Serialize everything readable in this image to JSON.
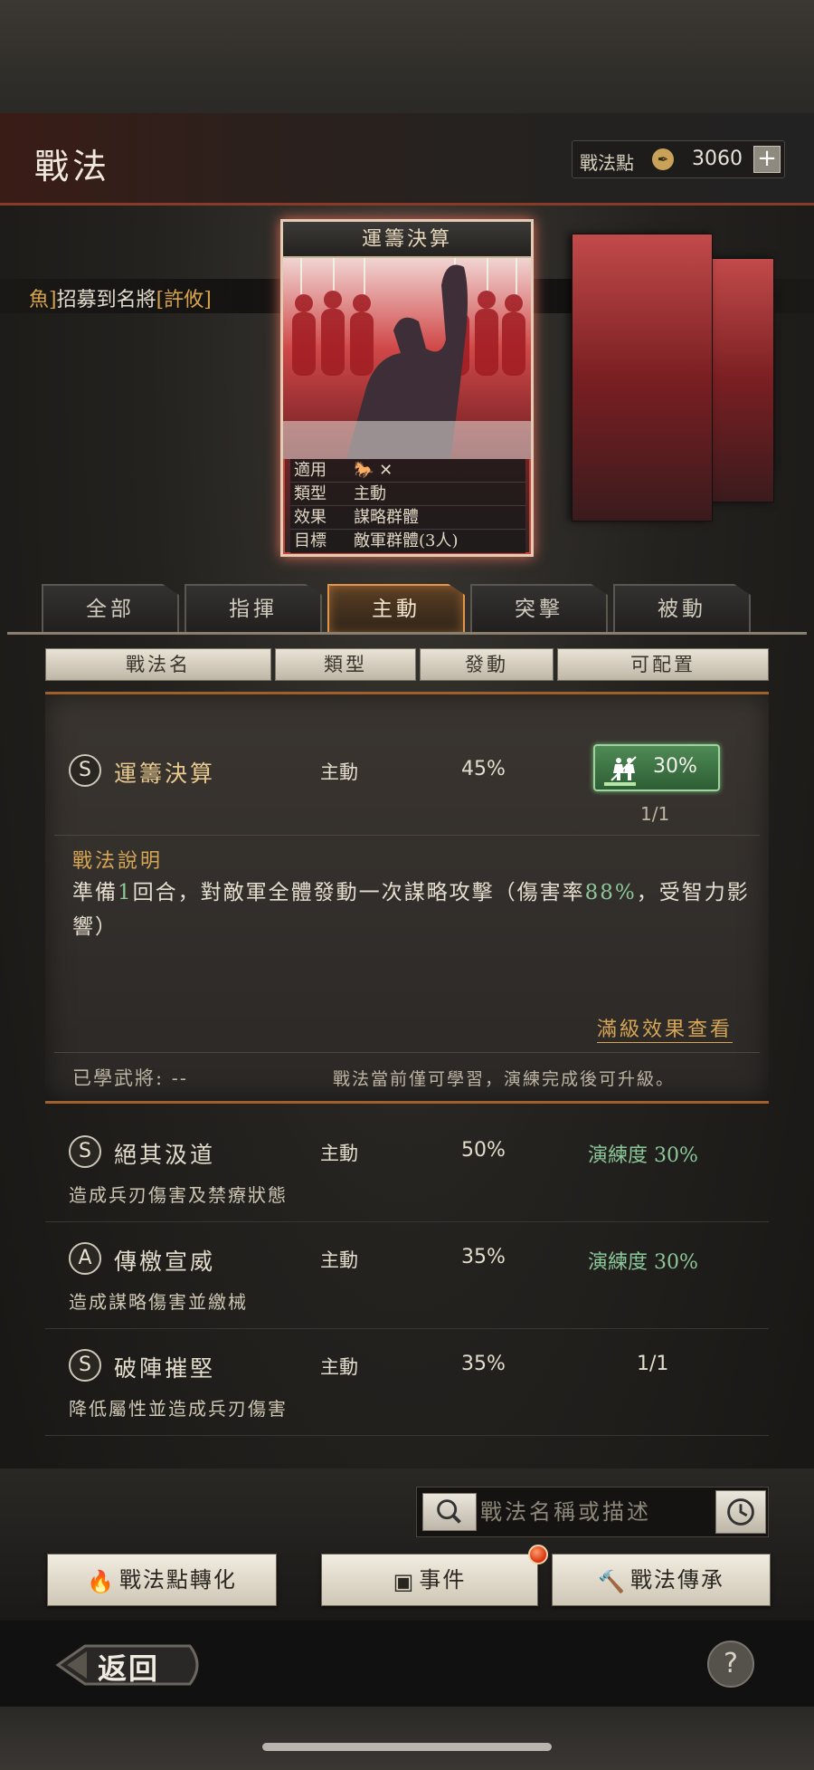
{
  "header": {
    "title": "戰法",
    "points_label": "戰法點",
    "points_value": "3060",
    "points_add": "+"
  },
  "ticker": {
    "prefix": "魚]",
    "middle": "招募到名將",
    "name": "[許攸]"
  },
  "card": {
    "title": "運籌決算",
    "info": [
      {
        "key": "適用",
        "value": ""
      },
      {
        "key": "類型",
        "value": "主動"
      },
      {
        "key": "效果",
        "value": "謀略群體"
      },
      {
        "key": "目標",
        "value": "敵軍群體(3人)"
      }
    ]
  },
  "tabs": [
    {
      "label": "全部",
      "active": false
    },
    {
      "label": "指揮",
      "active": false
    },
    {
      "label": "主動",
      "active": true
    },
    {
      "label": "突擊",
      "active": false
    },
    {
      "label": "被動",
      "active": false
    }
  ],
  "columns": [
    "戰法名",
    "類型",
    "發動",
    "可配置"
  ],
  "selected": {
    "grade": "S",
    "name": "運籌決算",
    "type": "主動",
    "rate": "45%",
    "badge_pct": "30%",
    "badge_progress": 0.3,
    "fraction": "1/1",
    "desc_title": "戰法說明",
    "desc_parts": [
      "準備",
      "1",
      "回合，對敵軍全體發動一次謀略攻擊（傷害率",
      "88%",
      "，受智力影響）"
    ],
    "full_effect": "滿級效果查看",
    "learned": "已學武將: --",
    "learn_note": "戰法當前僅可學習，演練完成後可升級。"
  },
  "skills": [
    {
      "grade": "S",
      "name": "絕其汲道",
      "type": "主動",
      "rate": "50%",
      "config": "演練度 30%",
      "desc": "造成兵刃傷害及禁療狀態",
      "config_style": "green"
    },
    {
      "grade": "A",
      "name": "傳檄宣威",
      "type": "主動",
      "rate": "35%",
      "config": "演練度 30%",
      "desc": "造成謀略傷害並繳械",
      "config_style": "green"
    },
    {
      "grade": "S",
      "name": "破陣摧堅",
      "type": "主動",
      "rate": "35%",
      "config": "1/1",
      "desc": "降低屬性並造成兵刃傷害",
      "config_style": "plain"
    }
  ],
  "search": {
    "placeholder": "戰法名稱或描述"
  },
  "buttons": {
    "convert": "戰法點轉化",
    "event": "事件",
    "inherit": "戰法傳承"
  },
  "footer": {
    "back": "返回",
    "help": "?"
  },
  "colors": {
    "accent_gold": "#d6a656",
    "progress_green": "#8cc79a",
    "active_tab": "#e0954a",
    "card_red": "#c94747"
  }
}
